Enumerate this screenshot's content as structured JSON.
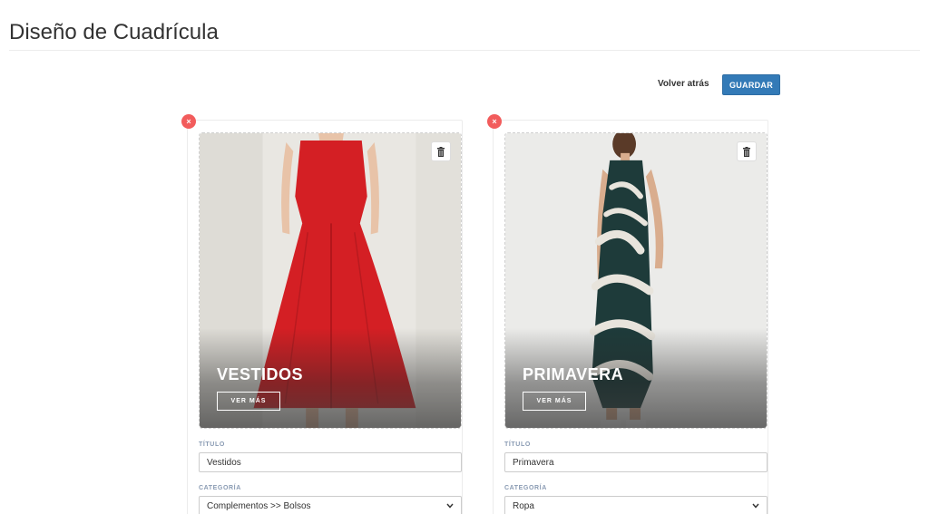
{
  "header": {
    "title": "Diseño de Cuadrícula"
  },
  "toolbar": {
    "back_label": "Volver atrás",
    "save_label": "GUARDAR"
  },
  "cards": [
    {
      "overlay_title": "VESTIDOS",
      "more_label": "VER MÁS",
      "title_label": "TÍTULO",
      "title_value": "Vestidos",
      "category_label": "CATEGORÍA",
      "category_value": "Complementos >> Bolsos",
      "remove_icon": "×"
    },
    {
      "overlay_title": "PRIMAVERA",
      "more_label": "VER MÁS",
      "title_label": "TÍTULO",
      "title_value": "Primavera",
      "category_label": "CATEGORÍA",
      "category_value": "Ropa",
      "remove_icon": "×"
    }
  ],
  "colors": {
    "primary": "#337ab7",
    "danger": "#f25c5c",
    "label": "#8a9bb3"
  }
}
